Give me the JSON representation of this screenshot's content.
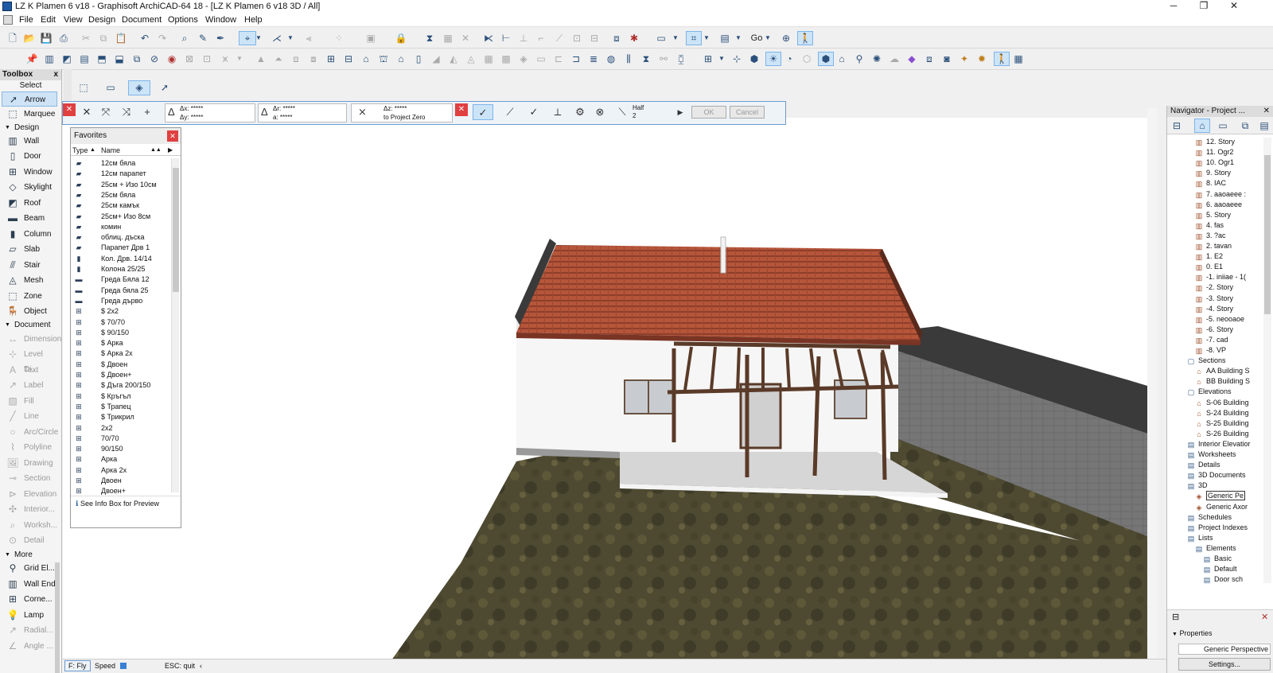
{
  "window": {
    "title": "LZ K Plamen 6 v18 - Graphisoft ArchiCAD-64 18 - [LZ K Plamen 6 v18 3D / All]",
    "controls": {
      "minimize": "─",
      "restore": "❐",
      "close": "✕"
    }
  },
  "menu": [
    "File",
    "Edit",
    "View",
    "Design",
    "Document",
    "Options",
    "Window",
    "Help"
  ],
  "toolbar": {
    "go_label": "Go"
  },
  "toolbox": {
    "title": "Toolbox",
    "close": "x",
    "select_label": "Select",
    "select_tools": [
      "Arrow",
      "Marquee"
    ],
    "design_group": "Design",
    "design_tools": [
      "Wall",
      "Door",
      "Window",
      "Skylight",
      "Roof",
      "Beam",
      "Column",
      "Slab",
      "Stair",
      "Mesh",
      "Zone",
      "Object"
    ],
    "document_group": "Document",
    "document_tools": [
      "Dimension",
      "Level Di...",
      "Text",
      "Label",
      "Fill",
      "Line",
      "Arc/Circle",
      "Polyline",
      "Drawing",
      "Section",
      "Elevation",
      "Interior...",
      "Worksh...",
      "Detail"
    ],
    "more_group": "More",
    "more_tools": [
      "Grid El...",
      "Wall End",
      "Corne...",
      "Lamp",
      "Radial...",
      "Angle ..."
    ]
  },
  "pet_palette": {
    "dx": "Δx: *****",
    "dy": "Δy: *****",
    "dr": "Δr: *****",
    "da": "a: *****",
    "dz": "Δz: *****",
    "dz_ref": "to Project Zero",
    "half_label": "Half",
    "half_value": "2",
    "ok": "OK",
    "cancel": "Cancel"
  },
  "favorites": {
    "title": "Favorites",
    "col_type": "Type",
    "col_name": "Name",
    "items": [
      {
        "icon": "slab",
        "name": "12см бяла"
      },
      {
        "icon": "slab",
        "name": "12см парапет"
      },
      {
        "icon": "slab",
        "name": "25см + Изо 10см"
      },
      {
        "icon": "slab",
        "name": "25см бяла"
      },
      {
        "icon": "slab",
        "name": "25см камък"
      },
      {
        "icon": "slab",
        "name": "25см+ Изо 8см"
      },
      {
        "icon": "slab",
        "name": "комин"
      },
      {
        "icon": "slab",
        "name": "облиц. дъска"
      },
      {
        "icon": "slab",
        "name": "Парапет Дрв 1"
      },
      {
        "icon": "column",
        "name": "Кол. Дрв. 14/14"
      },
      {
        "icon": "column",
        "name": "Колона 25/25"
      },
      {
        "icon": "beam",
        "name": "Греда Бяла 12"
      },
      {
        "icon": "beam",
        "name": "Греда бяла 25"
      },
      {
        "icon": "beam",
        "name": "Греда дърво"
      },
      {
        "icon": "window",
        "name": "$ 2x2"
      },
      {
        "icon": "window",
        "name": "$ 70/70"
      },
      {
        "icon": "window",
        "name": "$ 90/150"
      },
      {
        "icon": "window",
        "name": "$ Арка"
      },
      {
        "icon": "window",
        "name": "$ Арка 2x"
      },
      {
        "icon": "window",
        "name": "$ Двоен"
      },
      {
        "icon": "window",
        "name": "$ Двоен+"
      },
      {
        "icon": "window",
        "name": "$ Дъга 200/150"
      },
      {
        "icon": "window",
        "name": "$ Кръгъл"
      },
      {
        "icon": "window",
        "name": "$ Трапец"
      },
      {
        "icon": "window",
        "name": "$ Трикрил"
      },
      {
        "icon": "window",
        "name": "2x2"
      },
      {
        "icon": "window",
        "name": "70/70"
      },
      {
        "icon": "window",
        "name": "90/150"
      },
      {
        "icon": "window",
        "name": "Арка"
      },
      {
        "icon": "window",
        "name": "Арка 2x"
      },
      {
        "icon": "window",
        "name": "Двоен"
      },
      {
        "icon": "window",
        "name": "Двоен+"
      }
    ],
    "footer": "See Info Box for Preview"
  },
  "navigator": {
    "title": "Navigator - Project ...",
    "items": [
      {
        "level": 3,
        "icon": "story",
        "label": "12. Story"
      },
      {
        "level": 3,
        "icon": "story",
        "label": "11. Ogr2"
      },
      {
        "level": 3,
        "icon": "story",
        "label": "10. Ogr1"
      },
      {
        "level": 3,
        "icon": "story",
        "label": "9. Story"
      },
      {
        "level": 3,
        "icon": "story",
        "label": "8. IAC"
      },
      {
        "level": 3,
        "icon": "story",
        "label": "7. aaoaeee :"
      },
      {
        "level": 3,
        "icon": "story",
        "label": "6. aaoaeee"
      },
      {
        "level": 3,
        "icon": "story",
        "label": "5. Story"
      },
      {
        "level": 3,
        "icon": "story",
        "label": "4. fas"
      },
      {
        "level": 3,
        "icon": "story",
        "label": "3. ?ac"
      },
      {
        "level": 3,
        "icon": "story",
        "label": "2. tavan"
      },
      {
        "level": 3,
        "icon": "story",
        "label": "1. E2"
      },
      {
        "level": 3,
        "icon": "story",
        "label": "0. E1"
      },
      {
        "level": 3,
        "icon": "story",
        "label": "-1. iniiae - 1("
      },
      {
        "level": 3,
        "icon": "story",
        "label": "-2. Story"
      },
      {
        "level": 3,
        "icon": "story",
        "label": "-3. Story"
      },
      {
        "level": 3,
        "icon": "story",
        "label": "-4. Story"
      },
      {
        "level": 3,
        "icon": "story",
        "label": "-5. neooaoe"
      },
      {
        "level": 3,
        "icon": "story",
        "label": "-6. Story"
      },
      {
        "level": 3,
        "icon": "story",
        "label": "-7. cad"
      },
      {
        "level": 3,
        "icon": "story",
        "label": "-8. VP"
      },
      {
        "level": 2,
        "icon": "folder",
        "label": "Sections"
      },
      {
        "level": 3,
        "icon": "section",
        "label": "AA Building S"
      },
      {
        "level": 3,
        "icon": "section",
        "label": "BB Building S"
      },
      {
        "level": 2,
        "icon": "folder",
        "label": "Elevations"
      },
      {
        "level": 3,
        "icon": "section",
        "label": "S-06 Building"
      },
      {
        "level": 3,
        "icon": "section",
        "label": "S-24 Building"
      },
      {
        "level": 3,
        "icon": "section",
        "label": "S-25 Building"
      },
      {
        "level": 3,
        "icon": "section",
        "label": "S-26 Building"
      },
      {
        "level": 2,
        "icon": "doc",
        "label": "Interior Elevatior"
      },
      {
        "level": 2,
        "icon": "doc",
        "label": "Worksheets"
      },
      {
        "level": 2,
        "icon": "doc",
        "label": "Details"
      },
      {
        "level": 2,
        "icon": "doc",
        "label": "3D Documents"
      },
      {
        "level": 2,
        "icon": "doc",
        "label": "3D"
      },
      {
        "level": 3,
        "icon": "camera",
        "label": "Generic Pe",
        "selected": true
      },
      {
        "level": 3,
        "icon": "camera",
        "label": "Generic Axor"
      },
      {
        "level": 2,
        "icon": "doc",
        "label": "Schedules"
      },
      {
        "level": 2,
        "icon": "doc",
        "label": "Project Indexes"
      },
      {
        "level": 2,
        "icon": "doc",
        "label": "Lists"
      },
      {
        "level": 3,
        "icon": "doc",
        "label": "Elements"
      },
      {
        "level": 4,
        "icon": "doc",
        "label": "Basic"
      },
      {
        "level": 4,
        "icon": "doc",
        "label": "Default"
      },
      {
        "level": 4,
        "icon": "doc",
        "label": "Door sch"
      }
    ],
    "properties_label": "Properties",
    "properties_value": "Generic Perspective",
    "settings_button": "Settings..."
  },
  "statusbar": {
    "fly": "F: Fly",
    "speed": "Speed",
    "esc": "ESC: quit"
  },
  "colors": {
    "accent": "#cce4f7",
    "pet_border": "#6b9ad1",
    "close_red": "#e04040",
    "roof": "#b5553a",
    "wall": "#f4f4f4",
    "ground": "#4e4a32",
    "fence": "#6a6a6a"
  }
}
